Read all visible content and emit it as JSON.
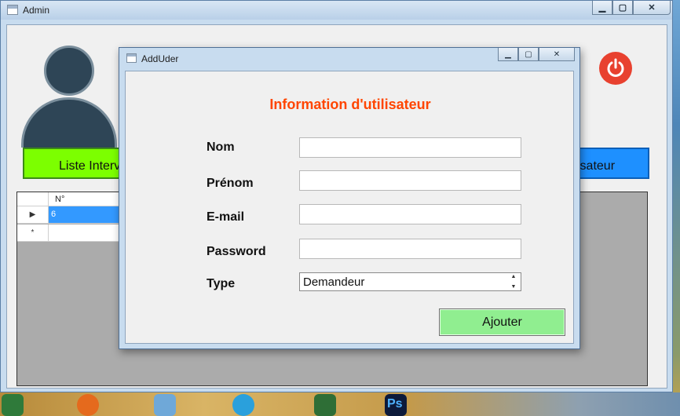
{
  "main_window": {
    "title": "Admin",
    "controls": {
      "minimize": "▁",
      "maximize": "▢",
      "close": "✕"
    }
  },
  "nav": {
    "left_button_label": "Liste Interv",
    "right_button_label": "isateur"
  },
  "grid": {
    "columns": [
      "N°"
    ],
    "rows": [
      {
        "marker": "▶",
        "values": [
          "6"
        ]
      },
      {
        "marker": "*",
        "values": [
          ""
        ]
      }
    ]
  },
  "dialog": {
    "title": "AddUder",
    "heading": "Information d'utilisateur",
    "fields": {
      "nom": {
        "label": "Nom",
        "value": ""
      },
      "prenom": {
        "label": "Prénom",
        "value": ""
      },
      "email": {
        "label": "E-mail",
        "value": ""
      },
      "password": {
        "label": "Password",
        "value": ""
      },
      "type": {
        "label": "Type",
        "value": "Demandeur"
      }
    },
    "submit_label": "Ajouter"
  },
  "colors": {
    "heading": "#ff4500",
    "nav_left": "#7cff00",
    "nav_right": "#1e90ff",
    "submit": "#90ee90",
    "power": "#e8412f"
  }
}
